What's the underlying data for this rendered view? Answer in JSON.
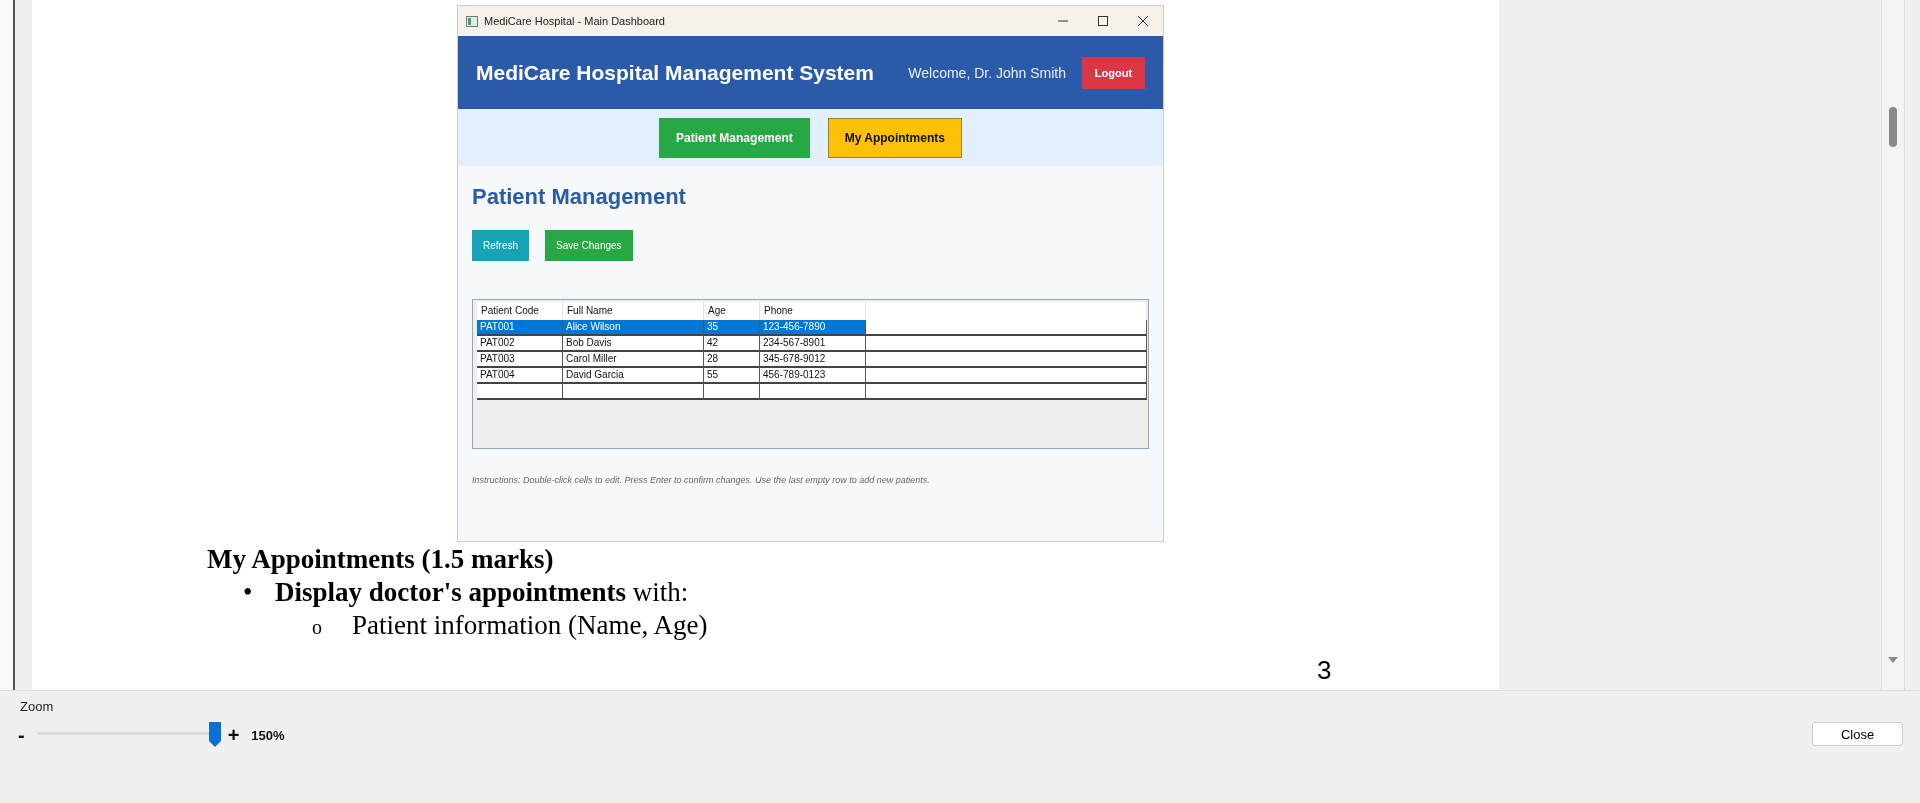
{
  "document": {
    "embedded_window": {
      "title": "MediCare Hospital - Main Dashboard",
      "header": {
        "title": "MediCare Hospital Management System",
        "welcome": "Welcome, Dr. John Smith",
        "logout": "Logout"
      },
      "nav": [
        {
          "label": "Patient Management",
          "kind": "green"
        },
        {
          "label": "My Appointments",
          "kind": "yellow"
        }
      ],
      "section_title": "Patient Management",
      "actions": [
        {
          "label": "Refresh",
          "kind": "teal"
        },
        {
          "label": "Save Changes",
          "kind": "green"
        }
      ],
      "table": {
        "columns": [
          "Patient Code",
          "Full Name",
          "Age",
          "Phone"
        ],
        "rows": [
          {
            "cells": [
              "PAT001",
              "Alice Wilson",
              "35",
              "123-456-7890"
            ],
            "selected": true
          },
          {
            "cells": [
              "PAT002",
              "Bob Davis",
              "42",
              "234-567-8901"
            ],
            "selected": false
          },
          {
            "cells": [
              "PAT003",
              "Carol Miller",
              "28",
              "345-678-9012"
            ],
            "selected": false
          },
          {
            "cells": [
              "PAT004",
              "David Garcia",
              "55",
              "456-789-0123"
            ],
            "selected": false
          }
        ]
      },
      "instructions": "Instructions: Double-click cells to edit. Press Enter to confirm changes. Use the last empty row to add new patients."
    },
    "heading": "My Appointments (1.5 marks)",
    "bullets": [
      {
        "marker": "•",
        "text": "**Display doctor's appointments** with:",
        "children": [
          {
            "marker": "o",
            "text": "Patient information (Name, Age)"
          }
        ]
      }
    ],
    "page_number": "3"
  },
  "zoom": {
    "label": "Zoom",
    "minus": "-",
    "plus": "+",
    "level": 1,
    "reading": "150%"
  },
  "close_button": "Close"
}
